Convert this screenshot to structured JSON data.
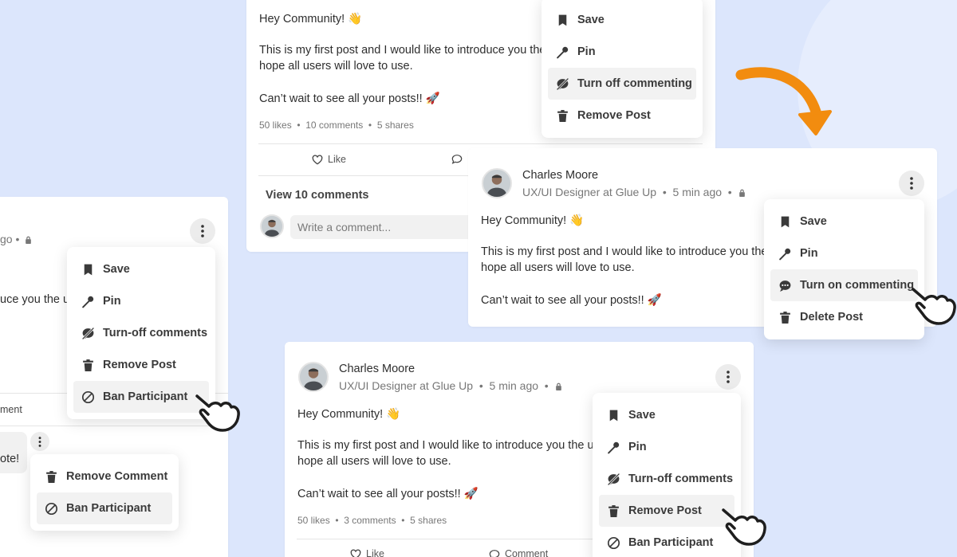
{
  "colors": {
    "background": "#dce6fc",
    "accent_arrow": "#f28c0f",
    "menu_text": "#3a3a3a"
  },
  "post": {
    "author": "Charles Moore",
    "role": "UX/UI Designer at Glue Up",
    "time": "5 min ago",
    "greeting": "Hey Community! 👋",
    "body_line1": "This is my first post and I would like to introduce you the",
    "body_line1_cut": "This is my first post and I would like to introduce you the up",
    "body_line2": "hope all users will love to use.",
    "closing": "Can’t wait to see all your posts!! 🚀",
    "like_label": "Like",
    "comment_label": "Comment",
    "comment_placeholder": "Write a comment..."
  },
  "left_card": {
    "meta_fragment": "go",
    "body_fragment": "uce you the up",
    "comment_fragment": "ment",
    "bubble_fragment": "ote!",
    "menu": [
      {
        "icon": "bookmark-icon",
        "label": "Save"
      },
      {
        "icon": "pin-icon",
        "label": "Pin"
      },
      {
        "icon": "comment-off-icon",
        "label": "Turn-off comments"
      },
      {
        "icon": "trash-icon",
        "label": "Remove Post"
      },
      {
        "icon": "ban-icon",
        "label": "Ban Participant"
      }
    ],
    "comment_menu": [
      {
        "icon": "trash-icon",
        "label": "Remove Comment"
      },
      {
        "icon": "ban-icon",
        "label": "Ban Participant"
      }
    ]
  },
  "top_card": {
    "stats": {
      "likes": "50 likes",
      "comments": "10 comments",
      "shares": "5 shares"
    },
    "view_comments": "View 10 comments",
    "menu": [
      {
        "icon": "bookmark-icon",
        "label": "Save"
      },
      {
        "icon": "pin-icon",
        "label": "Pin"
      },
      {
        "icon": "comment-off-icon",
        "label": "Turn off commenting"
      },
      {
        "icon": "trash-icon",
        "label": "Remove Post"
      }
    ]
  },
  "right_card": {
    "menu": [
      {
        "icon": "bookmark-icon",
        "label": "Save"
      },
      {
        "icon": "pin-icon",
        "label": "Pin"
      },
      {
        "icon": "comment-icon",
        "label": "Turn on commenting"
      },
      {
        "icon": "trash-icon",
        "label": "Delete Post"
      }
    ]
  },
  "bottom_card": {
    "stats": {
      "likes": "50 likes",
      "comments": "3 comments",
      "shares": "5 shares"
    },
    "menu": [
      {
        "icon": "bookmark-icon",
        "label": "Save"
      },
      {
        "icon": "pin-icon",
        "label": "Pin"
      },
      {
        "icon": "comment-off-icon",
        "label": "Turn-off comments"
      },
      {
        "icon": "trash-icon",
        "label": "Remove Post"
      },
      {
        "icon": "ban-icon",
        "label": "Ban Participant"
      }
    ]
  }
}
